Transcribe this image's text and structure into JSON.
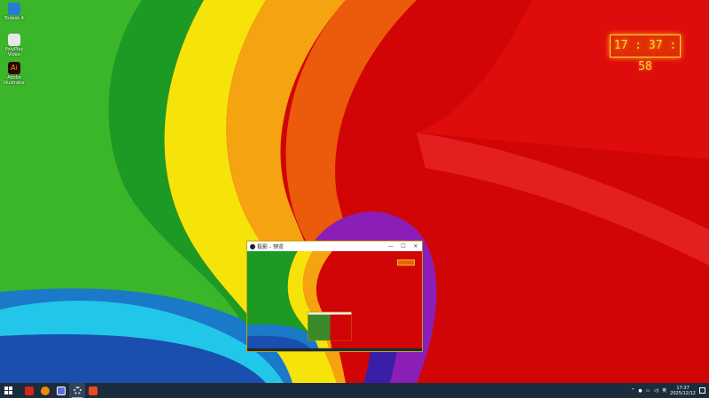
{
  "desktop": {
    "icons": [
      {
        "label": "Todesk 4"
      },
      {
        "label": "PolyPlay Video"
      },
      {
        "label": "Adobe Illustrator"
      }
    ],
    "clock_widget": {
      "time": "17 : 37 : 58",
      "color": "#ffd53d"
    }
  },
  "preview_window": {
    "title": "投影 - 预览",
    "controls": {
      "minimize": "—",
      "maximize": "☐",
      "close": "✕"
    }
  },
  "taskbar": {
    "apps": [
      {
        "name": "start-icon"
      },
      {
        "name": "adobe-icon"
      },
      {
        "name": "browser-icon"
      },
      {
        "name": "shield-app-icon"
      },
      {
        "name": "settings-gear-icon"
      },
      {
        "name": "record-app-icon"
      }
    ],
    "tray": {
      "ime": "英",
      "time": "17:37",
      "date": "2025/12/12"
    }
  }
}
